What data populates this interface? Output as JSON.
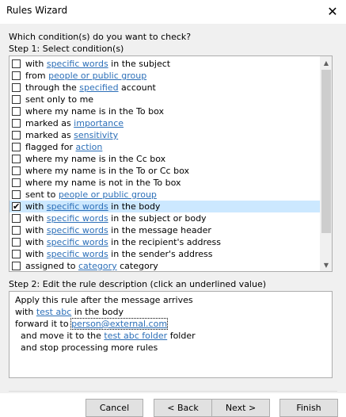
{
  "window": {
    "title": "Rules Wizard",
    "close_glyph": "✕"
  },
  "question": "Which condition(s) do you want to check?",
  "step1_label": "Step 1: Select condition(s)",
  "conditions": [
    {
      "checked": false,
      "selected": false,
      "parts": [
        {
          "t": "with ",
          "link": false
        },
        {
          "t": "specific words",
          "link": true
        },
        {
          "t": " in the subject",
          "link": false
        }
      ]
    },
    {
      "checked": false,
      "selected": false,
      "parts": [
        {
          "t": "from ",
          "link": false
        },
        {
          "t": "people or public group",
          "link": true
        }
      ]
    },
    {
      "checked": false,
      "selected": false,
      "parts": [
        {
          "t": "through the ",
          "link": false
        },
        {
          "t": "specified",
          "link": true
        },
        {
          "t": " account",
          "link": false
        }
      ]
    },
    {
      "checked": false,
      "selected": false,
      "parts": [
        {
          "t": "sent only to me",
          "link": false
        }
      ]
    },
    {
      "checked": false,
      "selected": false,
      "parts": [
        {
          "t": "where my name is in the To box",
          "link": false
        }
      ]
    },
    {
      "checked": false,
      "selected": false,
      "parts": [
        {
          "t": "marked as ",
          "link": false
        },
        {
          "t": "importance",
          "link": true
        }
      ]
    },
    {
      "checked": false,
      "selected": false,
      "parts": [
        {
          "t": "marked as ",
          "link": false
        },
        {
          "t": "sensitivity",
          "link": true
        }
      ]
    },
    {
      "checked": false,
      "selected": false,
      "parts": [
        {
          "t": "flagged for ",
          "link": false
        },
        {
          "t": "action",
          "link": true
        }
      ]
    },
    {
      "checked": false,
      "selected": false,
      "parts": [
        {
          "t": "where my name is in the Cc box",
          "link": false
        }
      ]
    },
    {
      "checked": false,
      "selected": false,
      "parts": [
        {
          "t": "where my name is in the To or Cc box",
          "link": false
        }
      ]
    },
    {
      "checked": false,
      "selected": false,
      "parts": [
        {
          "t": "where my name is not in the To box",
          "link": false
        }
      ]
    },
    {
      "checked": false,
      "selected": false,
      "parts": [
        {
          "t": "sent to ",
          "link": false
        },
        {
          "t": "people or public group",
          "link": true
        }
      ]
    },
    {
      "checked": true,
      "selected": true,
      "parts": [
        {
          "t": "with ",
          "link": false
        },
        {
          "t": "specific words",
          "link": true
        },
        {
          "t": " in the body",
          "link": false
        }
      ]
    },
    {
      "checked": false,
      "selected": false,
      "parts": [
        {
          "t": "with ",
          "link": false
        },
        {
          "t": "specific words",
          "link": true
        },
        {
          "t": " in the subject or body",
          "link": false
        }
      ]
    },
    {
      "checked": false,
      "selected": false,
      "parts": [
        {
          "t": "with ",
          "link": false
        },
        {
          "t": "specific words",
          "link": true
        },
        {
          "t": " in the message header",
          "link": false
        }
      ]
    },
    {
      "checked": false,
      "selected": false,
      "parts": [
        {
          "t": "with ",
          "link": false
        },
        {
          "t": "specific words",
          "link": true
        },
        {
          "t": " in the recipient's address",
          "link": false
        }
      ]
    },
    {
      "checked": false,
      "selected": false,
      "parts": [
        {
          "t": "with ",
          "link": false
        },
        {
          "t": "specific words",
          "link": true
        },
        {
          "t": " in the sender's address",
          "link": false
        }
      ]
    },
    {
      "checked": false,
      "selected": false,
      "parts": [
        {
          "t": "assigned to ",
          "link": false
        },
        {
          "t": "category",
          "link": true
        },
        {
          "t": " category",
          "link": false
        }
      ]
    }
  ],
  "step2_label": "Step 2: Edit the rule description (click an underlined value)",
  "description": [
    {
      "indent": false,
      "parts": [
        {
          "t": "Apply this rule after the message arrives",
          "link": false
        }
      ]
    },
    {
      "indent": false,
      "parts": [
        {
          "t": "with ",
          "link": false
        },
        {
          "t": "test abc",
          "link": true
        },
        {
          "t": " in the body",
          "link": false
        }
      ]
    },
    {
      "indent": false,
      "parts": [
        {
          "t": "forward it to ",
          "link": false
        },
        {
          "t": "person@external.com",
          "link": true,
          "focused": true
        }
      ]
    },
    {
      "indent": true,
      "parts": [
        {
          "t": "and move it to the ",
          "link": false
        },
        {
          "t": "test abc folder",
          "link": true
        },
        {
          "t": " folder",
          "link": false
        }
      ]
    },
    {
      "indent": true,
      "parts": [
        {
          "t": "and stop processing more rules",
          "link": false
        }
      ]
    }
  ],
  "buttons": {
    "cancel": "Cancel",
    "back": "< Back",
    "next": "Next >",
    "finish": "Finish"
  },
  "scroll_glyphs": {
    "up": "▲",
    "down": "▼"
  },
  "check_glyph": "✔",
  "colors": {
    "link": "#2c6fb8",
    "selection": "#cce8ff",
    "dialog_bg": "#f0f0f0"
  }
}
